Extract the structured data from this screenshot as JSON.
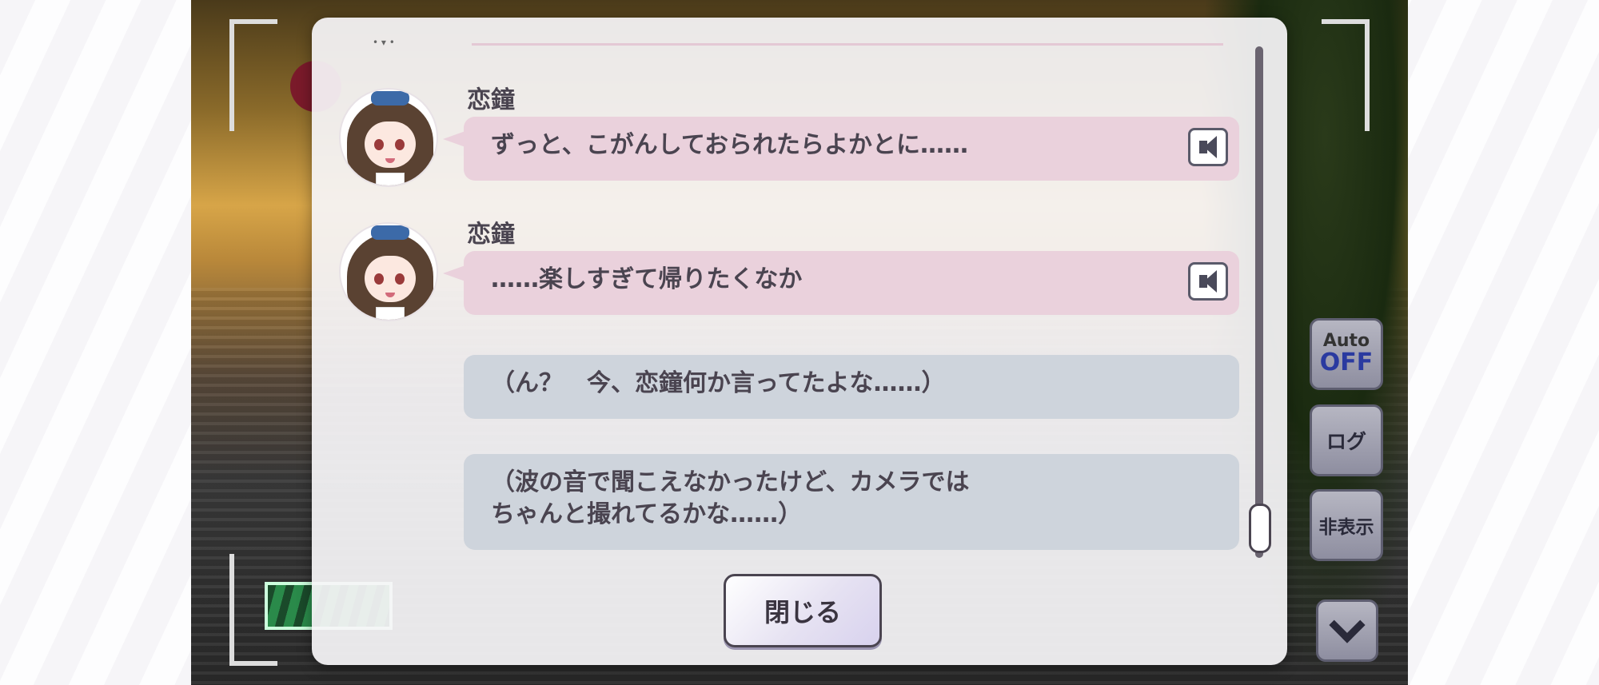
{
  "side_controls": {
    "auto_label": "Auto",
    "auto_state": "OFF",
    "log_label": "ログ",
    "hide_label": "非表示"
  },
  "log_entries": [
    {
      "speaker": "恋鐘",
      "text": "ずっと、こがんしておられたらよかとに……",
      "has_voice": true
    },
    {
      "speaker": "恋鐘",
      "text": "……楽しすぎて帰りたくなか",
      "has_voice": true
    },
    {
      "speaker": "",
      "text": "（ん？　今、恋鐘何か言ってたよな……）",
      "has_voice": false
    },
    {
      "speaker": "",
      "text_line1": "（波の音で聞こえなかったけど、カメラでは",
      "text_line2": "ちゃんと撮れてるかな……）",
      "has_voice": false
    }
  ],
  "close_label": "閉じる",
  "colors": {
    "character_bubble": "#ead1dc",
    "narration_bubble": "#ced4dc",
    "auto_off": "#2a3aa0"
  },
  "icons": [
    "voice-play-icon",
    "chevron-down-icon"
  ]
}
